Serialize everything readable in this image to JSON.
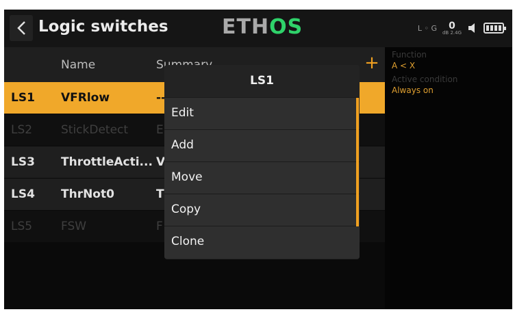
{
  "header": {
    "title": "Logic switches",
    "logo_part1": "ETH",
    "logo_part2": "OS",
    "rf_status": "L ◦ G",
    "rssi_value": "0",
    "rssi_unit": "dB 2.4G"
  },
  "table": {
    "col_name": "Name",
    "col_summary": "Summary",
    "add_label": "+",
    "rows": [
      {
        "id": "LS1",
        "name": "VFRlow",
        "summary": "--"
      },
      {
        "id": "LS2",
        "name": "StickDetect",
        "summary": "E"
      },
      {
        "id": "LS3",
        "name": "ThrottleActi...",
        "summary": "V"
      },
      {
        "id": "LS4",
        "name": "ThrNot0",
        "summary": "T"
      },
      {
        "id": "LS5",
        "name": "FSW",
        "summary": "F"
      }
    ]
  },
  "side": {
    "function_label": "Function",
    "function_value": "A < X",
    "active_label": "Active condition",
    "active_value": "Always on"
  },
  "modal": {
    "title": "LS1",
    "items": [
      "Edit",
      "Add",
      "Move",
      "Copy",
      "Clone"
    ]
  },
  "colors": {
    "accent": "#f0a020",
    "logo_green": "#2fd26a"
  }
}
